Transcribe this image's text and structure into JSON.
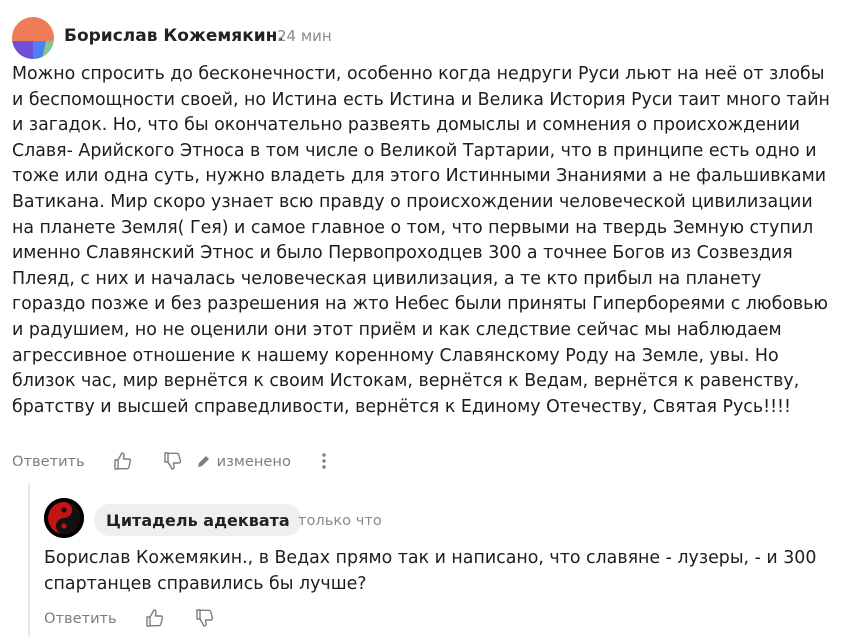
{
  "comment": {
    "author": "Борислав Кожемякин.",
    "time": "24 мин",
    "text": "Можно спросить до бесконечности, особенно когда недруги Руси льют на неё от злобы и беспомощности своей, но Истина есть Истина и Велика История Руси таит много тайн и загадок. Но, что бы окончательно развеять домыслы и сомнения о происхождении Славя- Арийского Этноса в том числе о Великой Тартарии, что в принципе есть одно и тоже или одна суть, нужно владеть для этого Истинными Знаниями а не фальшивками Ватикана. Мир скоро узнает всю правду о происхождении человеческой цивилизации на планете Земля( Гея) и самое главное о том, что первыми на твердь Земную ступил именно Славянский Этнос и было Первопроходцев 300 а точнее Богов из Созвездия Плеяд, с них и началась человеческая цивилизация, а те кто прибыл на планету гораздо позже и без разрешения на жто Небес были приняты Гипербореями с любовью и радушием, но не оценили они этот приём и как следствие сейчас мы наблюдаем агрессивное отношение к нашему коренному Славянскому Роду на Земле, увы. Но близок час, мир вернётся к своим Истокам, вернётся к Ведам, вернётся к равенству, братству и высшей справедливости, вернётся к Единому Отечеству, Святая Русь!!!!",
    "reply_label": "Ответить",
    "edited_label": "изменено"
  },
  "reply": {
    "author": "Цитадель адеквата",
    "time": "только что",
    "text": "Борислав Кожемякин., в Ведах прямо так и написано, что славяне - лузеры, - и 300 спартанцев справились бы лучше?",
    "reply_label": "Ответить"
  },
  "icons": {
    "like": "thumbs-up-icon",
    "dislike": "thumbs-down-icon",
    "edit": "pencil-icon",
    "more": "more-vertical-icon"
  },
  "colors": {
    "avatar_orange": "#ee7d57",
    "avatar_purple": "#6e4fd6",
    "avatar_green": "#7fc88f",
    "avatar_blue": "#4f7ff0",
    "meta_gray": "#7d7d7d",
    "pill_bg": "#efefef"
  }
}
